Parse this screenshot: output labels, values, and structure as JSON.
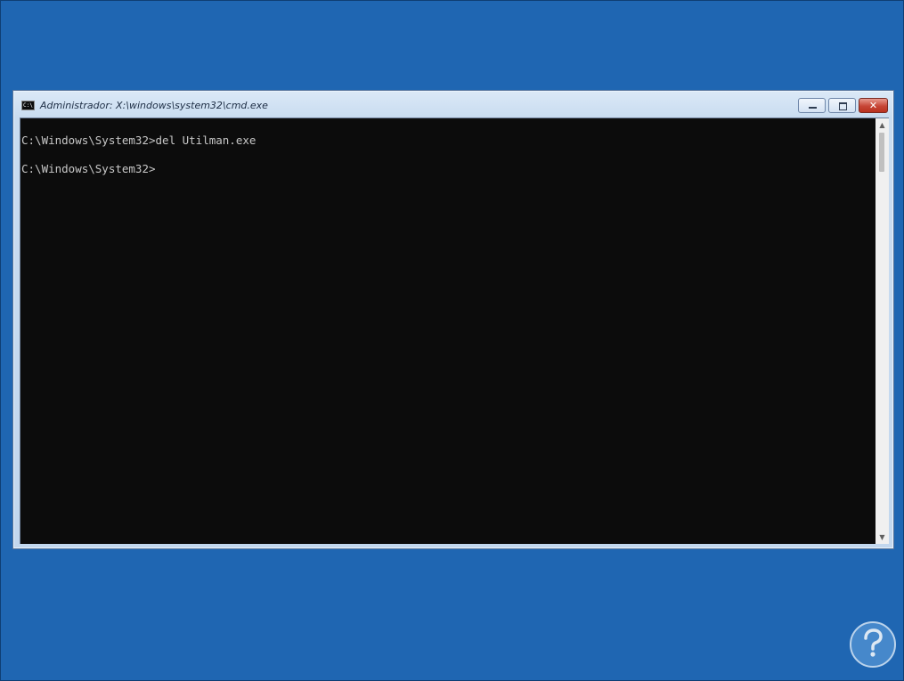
{
  "window": {
    "title": "Administrador: X:\\windows\\system32\\cmd.exe",
    "icon": "cmd-icon",
    "icon_text": "C:\\",
    "buttons": {
      "minimize": "minimize-icon",
      "maximize": "maximize-icon",
      "close": "close-icon",
      "close_glyph": "✕"
    }
  },
  "console": {
    "lines": [
      "C:\\Windows\\System32>del Utilman.exe",
      "",
      "C:\\Windows\\System32>"
    ],
    "background": "#0c0c0c",
    "foreground": "#c8c8c8"
  },
  "scrollbar": {
    "up_glyph": "▲",
    "down_glyph": "▼"
  },
  "desktop": {
    "background": "#1f66b2"
  },
  "logo": {
    "icon": "solvetic-logo-icon"
  }
}
